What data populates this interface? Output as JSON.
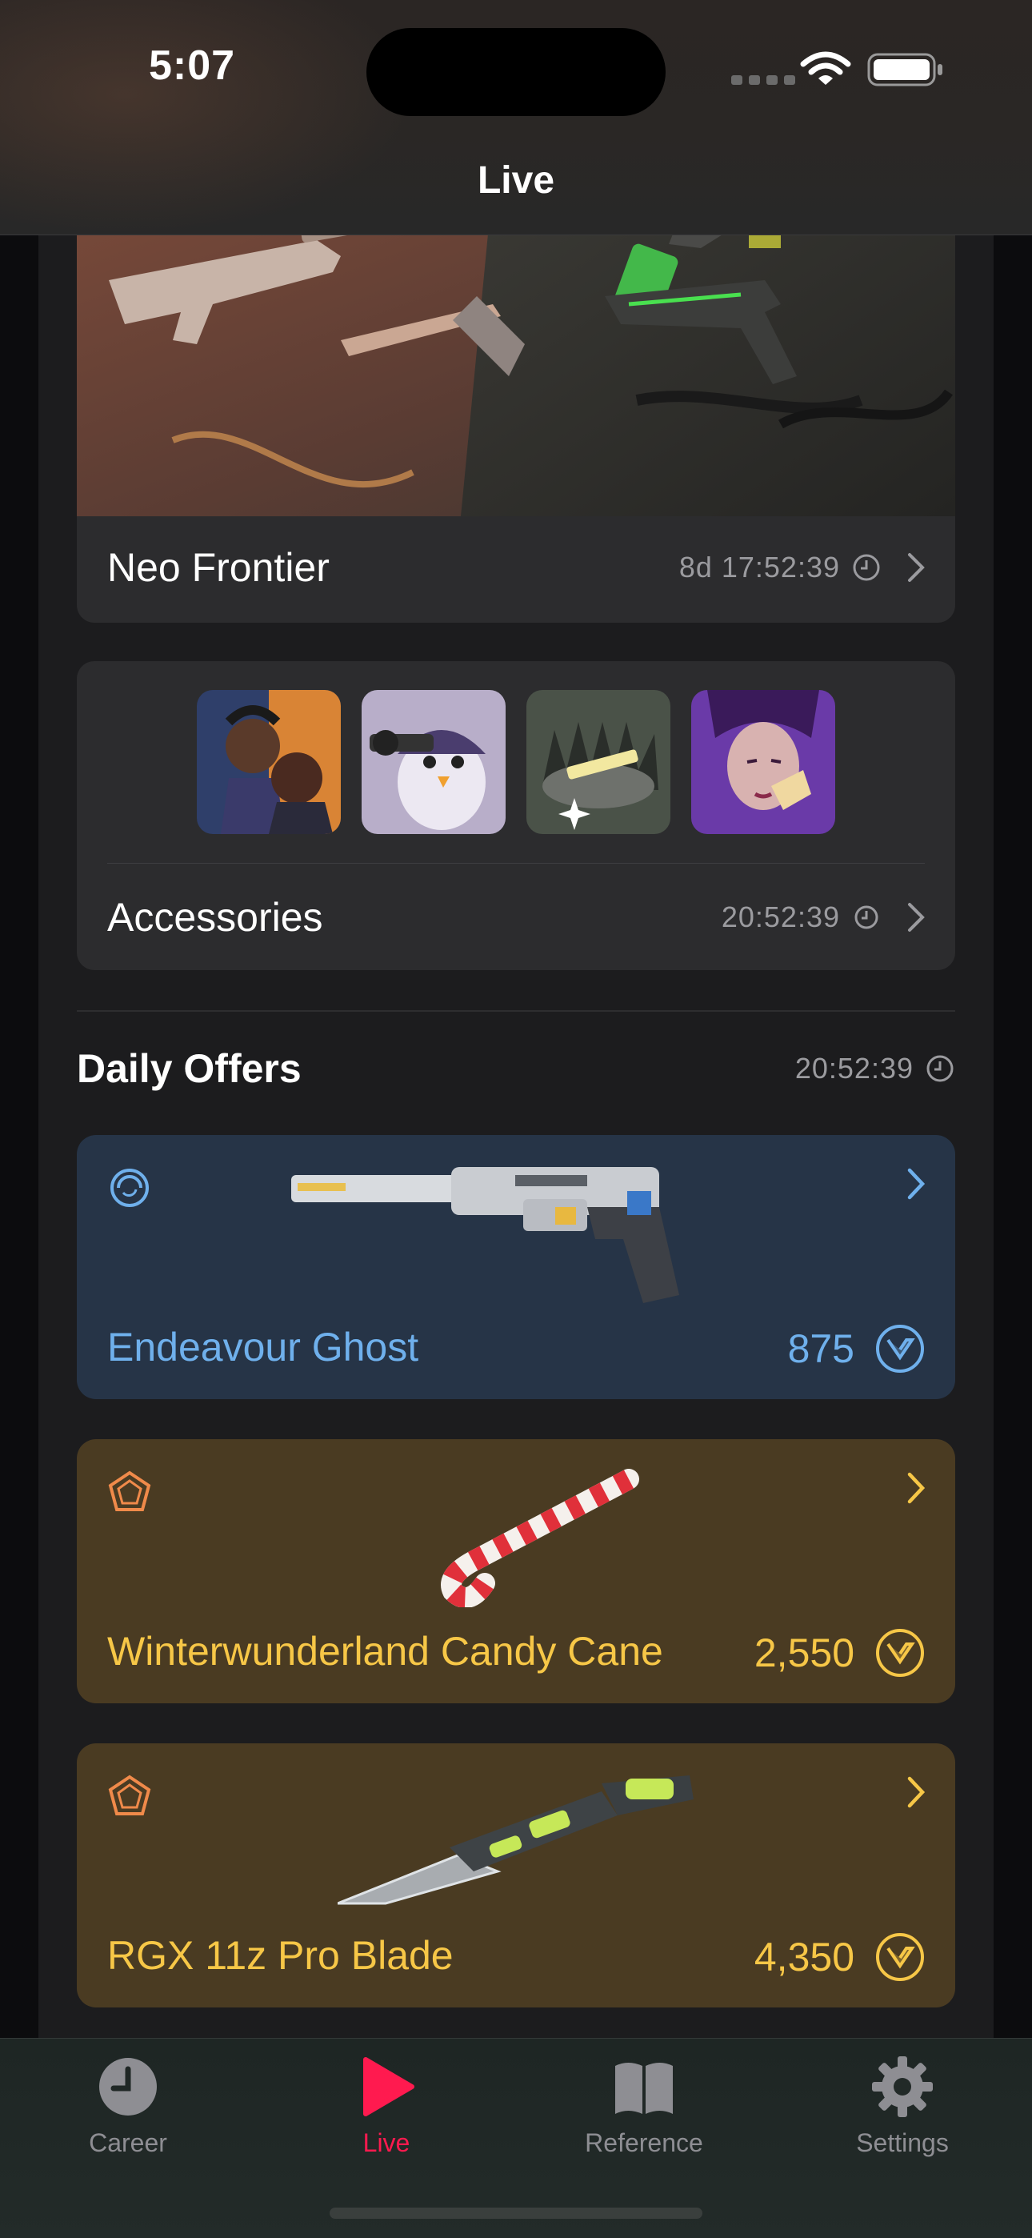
{
  "status_bar": {
    "time": "5:07"
  },
  "nav": {
    "title": "Live"
  },
  "featured": {
    "name": "Neo Frontier",
    "time_left": "8d 17:52:39"
  },
  "accessories": {
    "name": "Accessories",
    "time_left": "20:52:39",
    "items": [
      "accessory-card-duo",
      "accessory-spray-penguin",
      "accessory-buddy-trap",
      "accessory-card-woman"
    ]
  },
  "daily_offers": {
    "title": "Daily Offers",
    "time_left": "20:52:39",
    "items": [
      {
        "name": "Endeavour Ghost",
        "price": "875",
        "tier_icon": "select-tier-icon",
        "color": "#6fb0ec"
      },
      {
        "name": "Winterwunderland Candy Cane",
        "price": "2,550",
        "tier_icon": "exclusive-tier-icon",
        "color": "#f7c747"
      },
      {
        "name": "RGX 11z Pro Blade",
        "price": "4,350",
        "tier_icon": "exclusive-tier-icon",
        "color": "#f7c747"
      }
    ]
  },
  "tabs": [
    {
      "label": "Career",
      "icon": "clock-icon",
      "active": false
    },
    {
      "label": "Live",
      "icon": "play-icon",
      "active": true
    },
    {
      "label": "Reference",
      "icon": "book-icon",
      "active": false
    },
    {
      "label": "Settings",
      "icon": "gear-icon",
      "active": false
    }
  ],
  "colors": {
    "accent": "#ff1a4f",
    "select_blue": "#6fb0ec",
    "exclusive_gold": "#f7c747",
    "card_bg": "#2c2c2e"
  }
}
